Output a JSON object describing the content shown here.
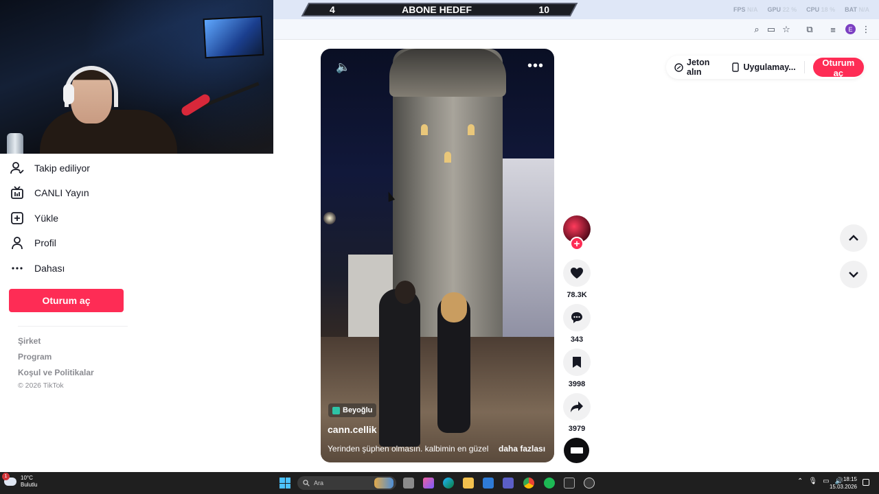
{
  "stream_banner": {
    "left_count": "4",
    "title": "ABONE HEDEF",
    "right_count": "10"
  },
  "perf_overlay": {
    "fps": {
      "label": "FPS",
      "value": "N/A"
    },
    "gpu": {
      "label": "GPU",
      "value": "22 %"
    },
    "cpu": {
      "label": "CPU",
      "value": "18 %"
    },
    "bat": {
      "label": "BAT",
      "value": "N/A"
    }
  },
  "sidebar": {
    "items": [
      {
        "label": "Takip ediliyor",
        "icon": "following-icon"
      },
      {
        "label": "CANLI Yayın",
        "icon": "live-icon"
      },
      {
        "label": "Yükle",
        "icon": "upload-icon"
      },
      {
        "label": "Profil",
        "icon": "profile-icon"
      },
      {
        "label": "Dahası",
        "icon": "more-icon"
      }
    ],
    "login_label": "Oturum aç",
    "footer": {
      "company": "Şirket",
      "program": "Program",
      "terms": "Koşul ve Politikalar",
      "copyright": "© 2026 TikTok"
    }
  },
  "video": {
    "location": "Beyoğlu",
    "username": "cann.cellik",
    "caption": "Yerinden şüphen olmasın. kalbimin en güzel",
    "more_label": "daha fazlası"
  },
  "actions": {
    "likes": "78.3K",
    "comments": "343",
    "saves": "3998",
    "shares": "3979"
  },
  "top_bar": {
    "coins_label": "Jeton alın",
    "app_label": "Uygulamay...",
    "login_label": "Oturum aç"
  },
  "taskbar": {
    "weather_temp": "10°C",
    "weather_desc": "Bulutlu",
    "weather_badge": "1",
    "search_placeholder": "Ara",
    "time": "18:15",
    "date": "15.03.2026"
  },
  "colors": {
    "accent": "#fe2c55",
    "text": "#161823",
    "muted": "#8a8b91"
  }
}
